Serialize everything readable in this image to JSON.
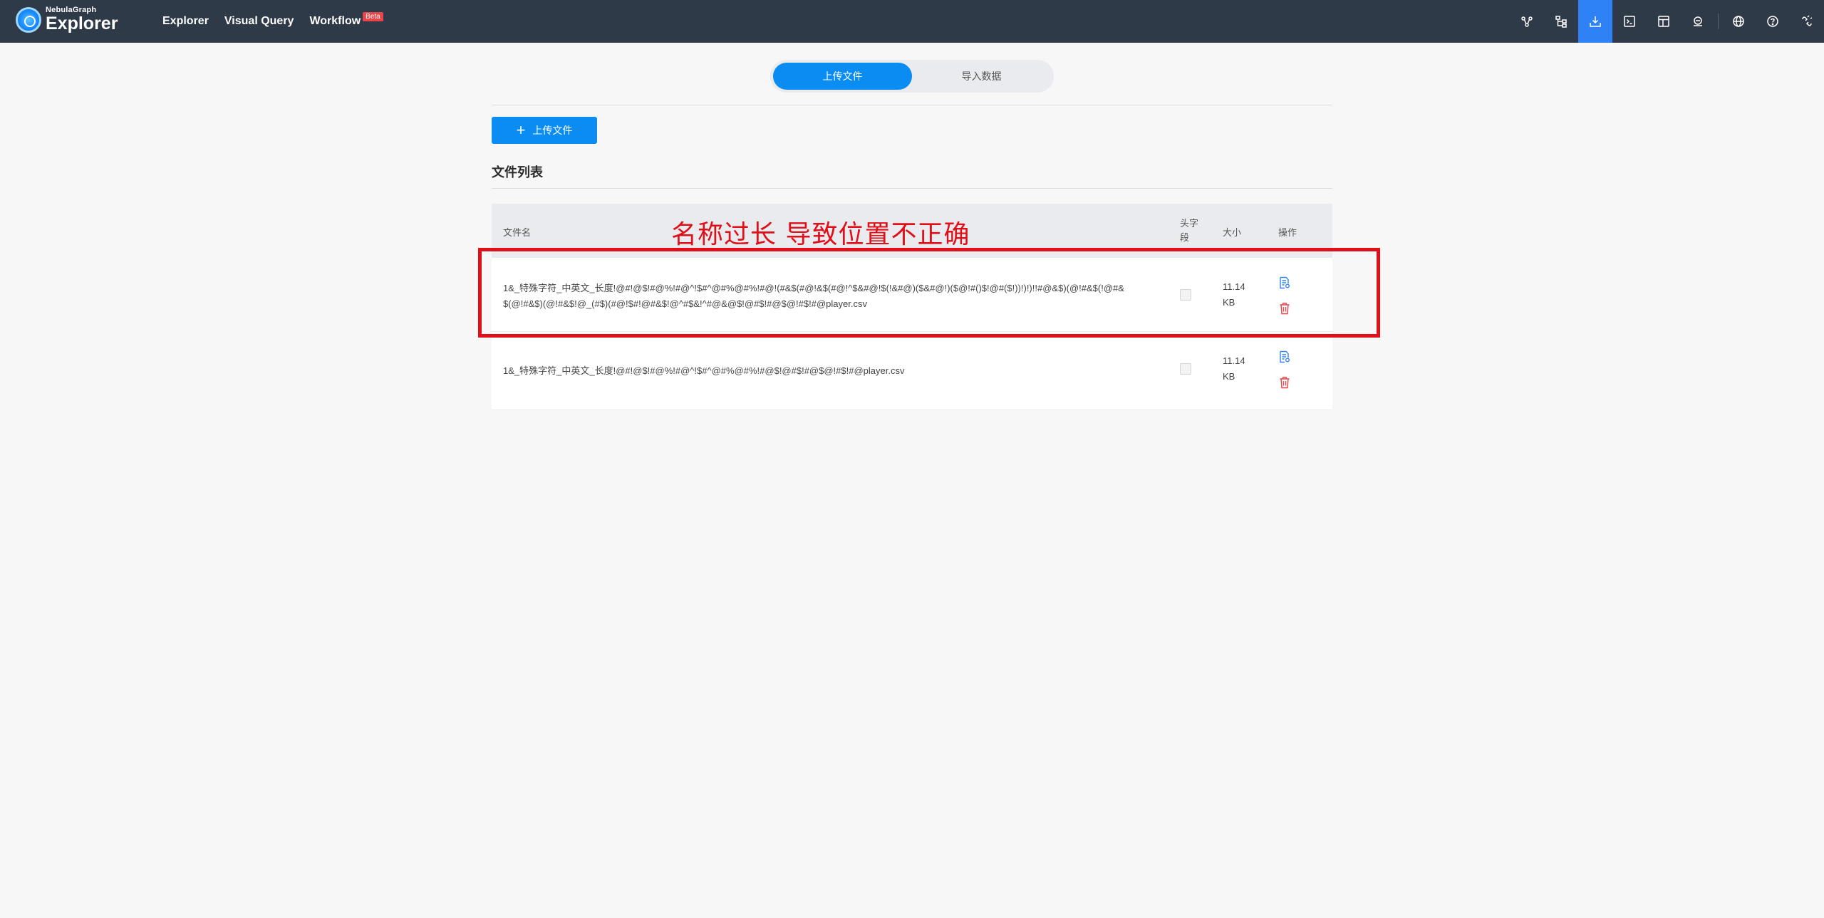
{
  "brand": {
    "small": "NebulaGraph",
    "big": "Explorer"
  },
  "nav": {
    "items": [
      {
        "label": "Explorer"
      },
      {
        "label": "Visual Query"
      },
      {
        "label": "Workflow",
        "badge": "Beta"
      }
    ]
  },
  "toolbar": {
    "icons": [
      "graph-icon",
      "schema-icon",
      "import-icon",
      "console-icon",
      "template-icon",
      "sketch-icon",
      "language-icon",
      "help-icon",
      "disconnect-icon"
    ],
    "active": "import-icon"
  },
  "tabs": {
    "upload": "上传文件",
    "import": "导入数据",
    "active": "upload"
  },
  "upload_button": {
    "label": "上传文件"
  },
  "file_list": {
    "title": "文件列表",
    "columns": {
      "name": "文件名",
      "header": "头字段",
      "size": "大小",
      "ops": "操作"
    },
    "rows": [
      {
        "name": "1&_特殊字符_中英文_长度!@#!@$!#@%!#@^!$#^@#%@#%!#@!(#&$(#@!&$(#@!^$&#@!$(!&#@)($&#@!)($@!#()$!@#($!))!)!)!!#@&$)(@!#&$(!@#&$(@!#&$)(@!#&$!@_(#$)(#@!$#!@#&$!@^#$&!^#@&@$!@#$!#@$@!#$!#@player.csv",
        "has_header": false,
        "size": "11.14 KB"
      },
      {
        "name": "1&_特殊字符_中英文_长度!@#!@$!#@%!#@^!$#^@#%@#%!#@$!@#$!#@$@!#$!#@player.csv",
        "has_header": false,
        "size": "11.14 KB"
      }
    ]
  },
  "annotation": {
    "text": "名称过长 导致位置不正确",
    "color": "#e0101a"
  },
  "colors": {
    "topbar": "#2f3a48",
    "accent": "#0a8cf2",
    "active_tool": "#2f82f5",
    "delete": "#e8464a"
  }
}
